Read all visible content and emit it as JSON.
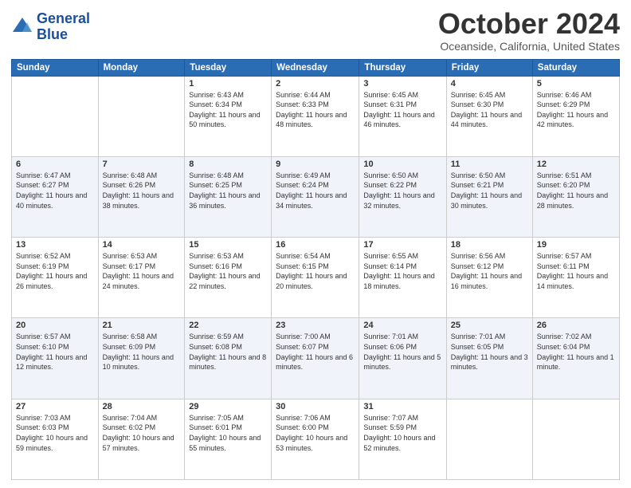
{
  "header": {
    "logo_line1": "General",
    "logo_line2": "Blue",
    "month": "October 2024",
    "location": "Oceanside, California, United States"
  },
  "days_of_week": [
    "Sunday",
    "Monday",
    "Tuesday",
    "Wednesday",
    "Thursday",
    "Friday",
    "Saturday"
  ],
  "weeks": [
    [
      {
        "day": "",
        "sunrise": "",
        "sunset": "",
        "daylight": ""
      },
      {
        "day": "",
        "sunrise": "",
        "sunset": "",
        "daylight": ""
      },
      {
        "day": "1",
        "sunrise": "Sunrise: 6:43 AM",
        "sunset": "Sunset: 6:34 PM",
        "daylight": "Daylight: 11 hours and 50 minutes."
      },
      {
        "day": "2",
        "sunrise": "Sunrise: 6:44 AM",
        "sunset": "Sunset: 6:33 PM",
        "daylight": "Daylight: 11 hours and 48 minutes."
      },
      {
        "day": "3",
        "sunrise": "Sunrise: 6:45 AM",
        "sunset": "Sunset: 6:31 PM",
        "daylight": "Daylight: 11 hours and 46 minutes."
      },
      {
        "day": "4",
        "sunrise": "Sunrise: 6:45 AM",
        "sunset": "Sunset: 6:30 PM",
        "daylight": "Daylight: 11 hours and 44 minutes."
      },
      {
        "day": "5",
        "sunrise": "Sunrise: 6:46 AM",
        "sunset": "Sunset: 6:29 PM",
        "daylight": "Daylight: 11 hours and 42 minutes."
      }
    ],
    [
      {
        "day": "6",
        "sunrise": "Sunrise: 6:47 AM",
        "sunset": "Sunset: 6:27 PM",
        "daylight": "Daylight: 11 hours and 40 minutes."
      },
      {
        "day": "7",
        "sunrise": "Sunrise: 6:48 AM",
        "sunset": "Sunset: 6:26 PM",
        "daylight": "Daylight: 11 hours and 38 minutes."
      },
      {
        "day": "8",
        "sunrise": "Sunrise: 6:48 AM",
        "sunset": "Sunset: 6:25 PM",
        "daylight": "Daylight: 11 hours and 36 minutes."
      },
      {
        "day": "9",
        "sunrise": "Sunrise: 6:49 AM",
        "sunset": "Sunset: 6:24 PM",
        "daylight": "Daylight: 11 hours and 34 minutes."
      },
      {
        "day": "10",
        "sunrise": "Sunrise: 6:50 AM",
        "sunset": "Sunset: 6:22 PM",
        "daylight": "Daylight: 11 hours and 32 minutes."
      },
      {
        "day": "11",
        "sunrise": "Sunrise: 6:50 AM",
        "sunset": "Sunset: 6:21 PM",
        "daylight": "Daylight: 11 hours and 30 minutes."
      },
      {
        "day": "12",
        "sunrise": "Sunrise: 6:51 AM",
        "sunset": "Sunset: 6:20 PM",
        "daylight": "Daylight: 11 hours and 28 minutes."
      }
    ],
    [
      {
        "day": "13",
        "sunrise": "Sunrise: 6:52 AM",
        "sunset": "Sunset: 6:19 PM",
        "daylight": "Daylight: 11 hours and 26 minutes."
      },
      {
        "day": "14",
        "sunrise": "Sunrise: 6:53 AM",
        "sunset": "Sunset: 6:17 PM",
        "daylight": "Daylight: 11 hours and 24 minutes."
      },
      {
        "day": "15",
        "sunrise": "Sunrise: 6:53 AM",
        "sunset": "Sunset: 6:16 PM",
        "daylight": "Daylight: 11 hours and 22 minutes."
      },
      {
        "day": "16",
        "sunrise": "Sunrise: 6:54 AM",
        "sunset": "Sunset: 6:15 PM",
        "daylight": "Daylight: 11 hours and 20 minutes."
      },
      {
        "day": "17",
        "sunrise": "Sunrise: 6:55 AM",
        "sunset": "Sunset: 6:14 PM",
        "daylight": "Daylight: 11 hours and 18 minutes."
      },
      {
        "day": "18",
        "sunrise": "Sunrise: 6:56 AM",
        "sunset": "Sunset: 6:12 PM",
        "daylight": "Daylight: 11 hours and 16 minutes."
      },
      {
        "day": "19",
        "sunrise": "Sunrise: 6:57 AM",
        "sunset": "Sunset: 6:11 PM",
        "daylight": "Daylight: 11 hours and 14 minutes."
      }
    ],
    [
      {
        "day": "20",
        "sunrise": "Sunrise: 6:57 AM",
        "sunset": "Sunset: 6:10 PM",
        "daylight": "Daylight: 11 hours and 12 minutes."
      },
      {
        "day": "21",
        "sunrise": "Sunrise: 6:58 AM",
        "sunset": "Sunset: 6:09 PM",
        "daylight": "Daylight: 11 hours and 10 minutes."
      },
      {
        "day": "22",
        "sunrise": "Sunrise: 6:59 AM",
        "sunset": "Sunset: 6:08 PM",
        "daylight": "Daylight: 11 hours and 8 minutes."
      },
      {
        "day": "23",
        "sunrise": "Sunrise: 7:00 AM",
        "sunset": "Sunset: 6:07 PM",
        "daylight": "Daylight: 11 hours and 6 minutes."
      },
      {
        "day": "24",
        "sunrise": "Sunrise: 7:01 AM",
        "sunset": "Sunset: 6:06 PM",
        "daylight": "Daylight: 11 hours and 5 minutes."
      },
      {
        "day": "25",
        "sunrise": "Sunrise: 7:01 AM",
        "sunset": "Sunset: 6:05 PM",
        "daylight": "Daylight: 11 hours and 3 minutes."
      },
      {
        "day": "26",
        "sunrise": "Sunrise: 7:02 AM",
        "sunset": "Sunset: 6:04 PM",
        "daylight": "Daylight: 11 hours and 1 minute."
      }
    ],
    [
      {
        "day": "27",
        "sunrise": "Sunrise: 7:03 AM",
        "sunset": "Sunset: 6:03 PM",
        "daylight": "Daylight: 10 hours and 59 minutes."
      },
      {
        "day": "28",
        "sunrise": "Sunrise: 7:04 AM",
        "sunset": "Sunset: 6:02 PM",
        "daylight": "Daylight: 10 hours and 57 minutes."
      },
      {
        "day": "29",
        "sunrise": "Sunrise: 7:05 AM",
        "sunset": "Sunset: 6:01 PM",
        "daylight": "Daylight: 10 hours and 55 minutes."
      },
      {
        "day": "30",
        "sunrise": "Sunrise: 7:06 AM",
        "sunset": "Sunset: 6:00 PM",
        "daylight": "Daylight: 10 hours and 53 minutes."
      },
      {
        "day": "31",
        "sunrise": "Sunrise: 7:07 AM",
        "sunset": "Sunset: 5:59 PM",
        "daylight": "Daylight: 10 hours and 52 minutes."
      },
      {
        "day": "",
        "sunrise": "",
        "sunset": "",
        "daylight": ""
      },
      {
        "day": "",
        "sunrise": "",
        "sunset": "",
        "daylight": ""
      }
    ]
  ]
}
